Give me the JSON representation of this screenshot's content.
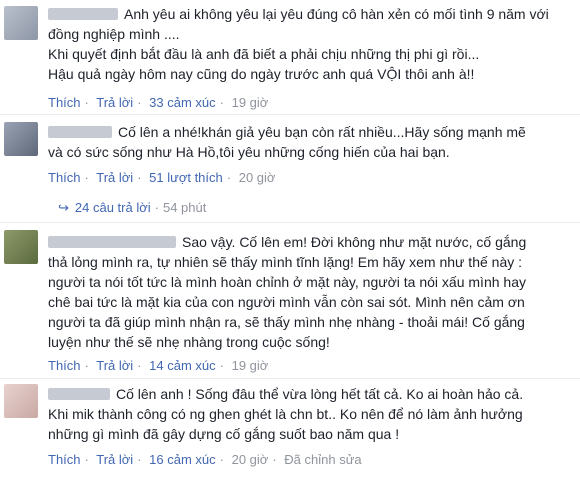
{
  "comments": [
    {
      "text_lines": [
        "Anh yêu ai không yêu lại yêu đúng cô hàn xẻn có mối tình 9 năm với",
        "đồng nghiệp mình ....",
        "Khi quyết định bắt đầu là anh đã biết a phải chịu những thị phi gì rồi...",
        "Hậu quả ngày hôm nay cũng do ngày trước anh quá VỘI thôi anh à!!"
      ],
      "like": "Thích",
      "reply": "Trả lời",
      "reactions": "33 cảm xúc",
      "time": "19 giờ"
    },
    {
      "text_lines": [
        "Cố lên a nhé!khán giả yêu bạn còn rất nhiều...Hãy sống mạnh mẽ",
        "và có sức sống như Hà Hồ,tôi yêu những cống hiến của hai bạn."
      ],
      "like": "Thích",
      "reply": "Trả lời",
      "reactions": "51 lượt thích",
      "time": "20 giờ",
      "replies_link": "24 câu trả lời",
      "replies_time": "54 phút"
    },
    {
      "text_lines": [
        "Sao vậy. Cố lên em! Đời không như mặt nước, cố gắng",
        "thả lỏng mình ra, tự nhiên sẽ thấy mình tĩnh lặng! Em hãy xem như thế này :",
        "người ta nói tốt tức là mình hoàn chỉnh ở mặt này, người ta nói xấu mình hay",
        "chê bai tức là mặt kia của con người mình vẫn còn sai sót. Mình nên cảm ơn",
        "người ta đã giúp mình nhận ra, sẽ thấy mình nhẹ nhàng - thoải mái! Cố gắng",
        "luyện như thế sẽ nhẹ nhàng trong cuộc sống!"
      ],
      "like": "Thích",
      "reply": "Trả lời",
      "reactions": "14 cảm xúc",
      "time": "19 giờ"
    },
    {
      "text_lines": [
        "Cố lên anh ! Sống đâu thể vừa lòng hết tất cả. Ko ai hoàn hảo cả.",
        "Khi mik thành công có ng ghen ghét là chn bt.. Ko nên để nó làm ảnh hưởng",
        "những gì mình đã gây dựng cố gắng suốt bao năm qua !"
      ],
      "like": "Thích",
      "reply": "Trả lời",
      "reactions": "16 cảm xúc",
      "time": "20 giờ",
      "edited": "Đã chỉnh sửa"
    }
  ]
}
